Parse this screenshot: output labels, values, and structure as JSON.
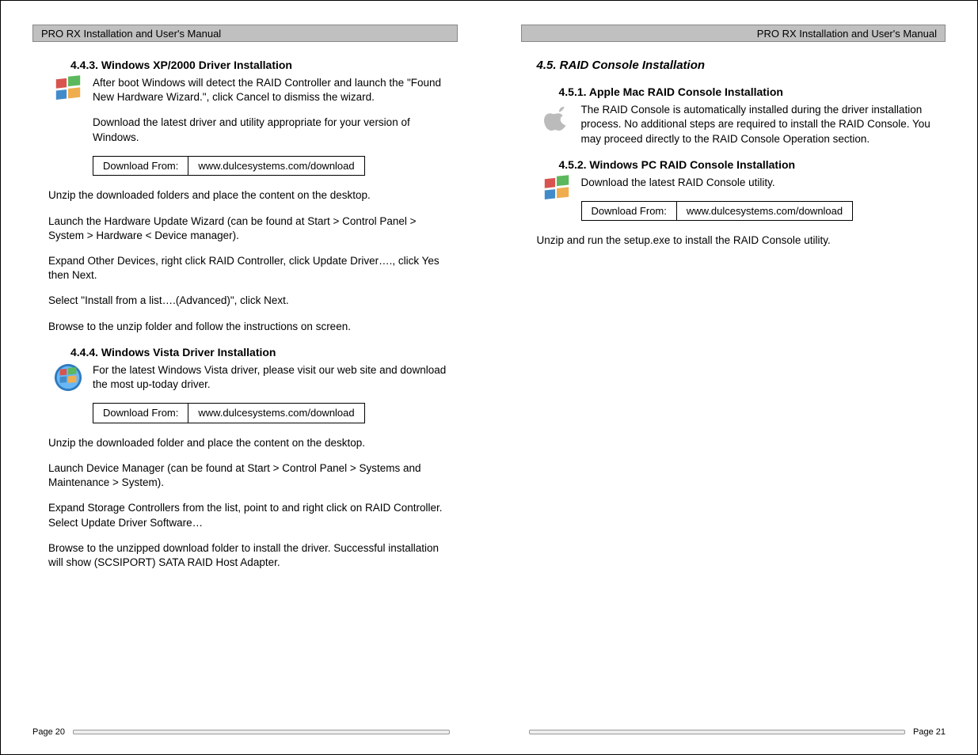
{
  "header": {
    "title": "PRO RX Installation and User's Manual"
  },
  "left": {
    "s443": {
      "heading": "4.4.3. Windows XP/2000 Driver Installation",
      "p1": "After boot Windows will detect the RAID Controller and launch the \"Found New Hardware Wizard.\", click Cancel to dismiss the wizard.",
      "p2": "Download the latest driver and utility appropriate for your version of Windows.",
      "dl_label": "Download From:",
      "dl_url": "www.dulcesystems.com/download",
      "p3": "Unzip the downloaded folders and place the content on the desktop.",
      "p4": "Launch the Hardware Update Wizard (can be found at Start > Control Panel > System > Hardware < Device manager).",
      "p5": "Expand Other Devices, right click RAID Controller, click Update Driver…., click Yes then Next.",
      "p6": "Select \"Install from a list….(Advanced)\", click Next.",
      "p7": "Browse to the unzip folder and follow the instructions on screen."
    },
    "s444": {
      "heading": "4.4.4. Windows Vista Driver Installation",
      "p1": "For the latest Windows Vista driver, please visit our web site and download the most up-today driver.",
      "dl_label": "Download From:",
      "dl_url": "www.dulcesystems.com/download",
      "p2": "Unzip the downloaded folder and place the content on the desktop.",
      "p3": "Launch Device Manager (can be found at Start > Control Panel > Systems and Maintenance > System).",
      "p4": "Expand Storage Controllers from the list, point to and right click on RAID Controller.   Select Update Driver Software…",
      "p5": "Browse to the unzipped download folder to install the driver.  Successful installation will show (SCSIPORT) SATA RAID Host Adapter."
    },
    "page_no": "Page 20"
  },
  "right": {
    "s45": {
      "heading": "4.5.      RAID Console Installation"
    },
    "s451": {
      "heading": "4.5.1. Apple Mac RAID Console Installation",
      "p1": "The RAID Console is automatically installed during the driver installation process.  No additional steps are required to install the RAID Console.  You may proceed directly to the RAID Console Operation section."
    },
    "s452": {
      "heading": "4.5.2. Windows PC RAID Console Installation",
      "p1": "Download the latest RAID Console utility.",
      "dl_label": "Download From:",
      "dl_url": "www.dulcesystems.com/download",
      "p2": "Unzip and run the setup.exe to install the RAID Console utility."
    },
    "page_no": "Page 21"
  }
}
